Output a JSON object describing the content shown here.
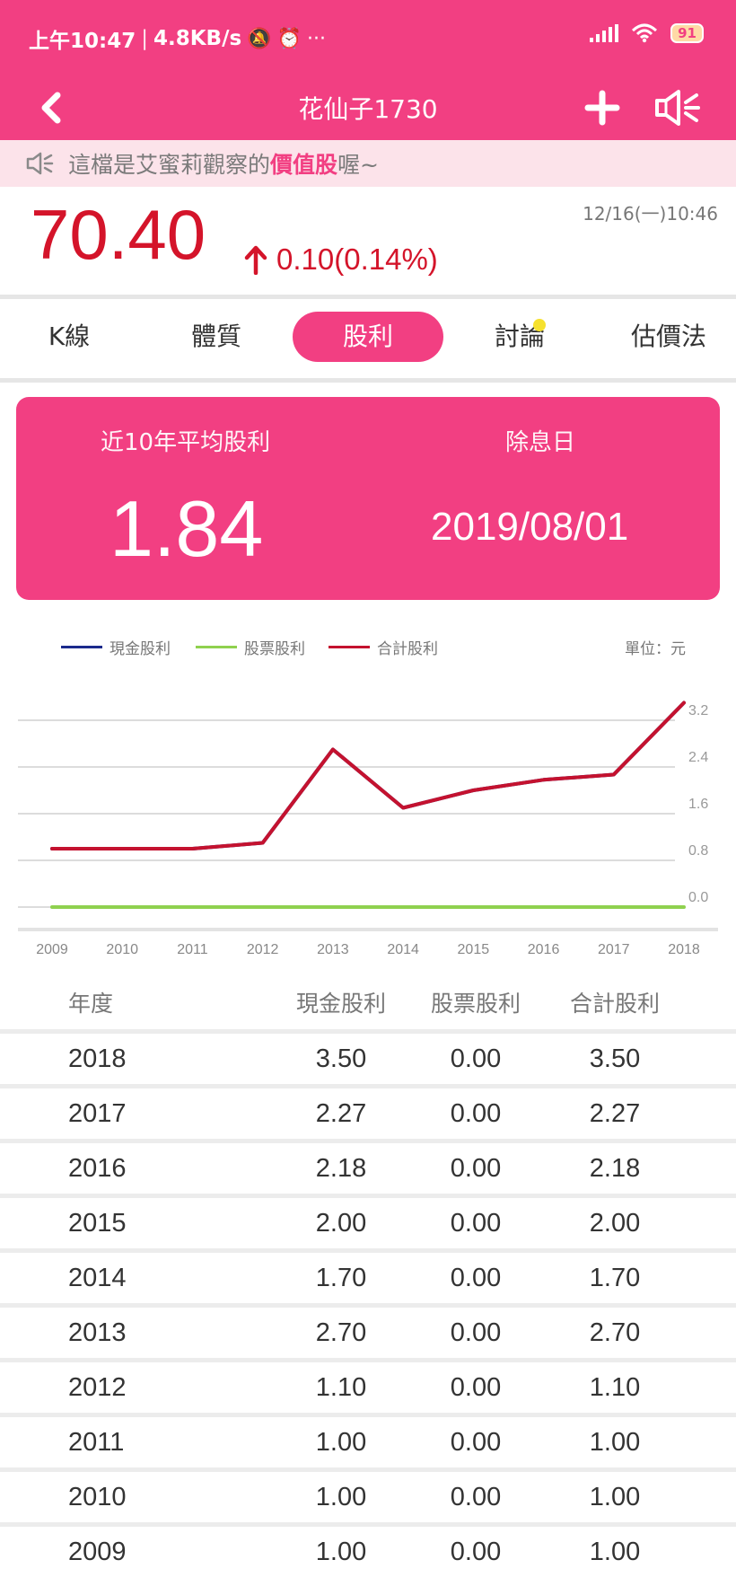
{
  "status_bar": {
    "time": "上午10:47",
    "speed": "4.8KB/s",
    "battery": "91"
  },
  "nav": {
    "title": "花仙子1730"
  },
  "notice": {
    "prefix": "這檔是艾蜜莉觀察的",
    "highlight": "價值股",
    "suffix": "喔~"
  },
  "quote": {
    "price": "70.40",
    "change": "0.10(0.14%)",
    "timestamp": "12/16(一)10:46",
    "color": "#d4142a"
  },
  "tabs": [
    {
      "label": "K線",
      "active": false
    },
    {
      "label": "體質",
      "active": false
    },
    {
      "label": "股利",
      "active": true
    },
    {
      "label": "討論",
      "active": false
    },
    {
      "label": "估價法",
      "active": false
    }
  ],
  "summary": {
    "avg_label": "近10年平均股利",
    "avg_value": "1.84",
    "exdiv_label": "除息日",
    "exdiv_value": "2019/08/01"
  },
  "legend": {
    "unit": "單位：元",
    "items": [
      {
        "label": "現金股利",
        "color": "#1b2a8c"
      },
      {
        "label": "股票股利",
        "color": "#8fd14f"
      },
      {
        "label": "合計股利",
        "color": "#c4122f"
      }
    ]
  },
  "chart_data": {
    "type": "line",
    "x": [
      "2009",
      "2010",
      "2011",
      "2012",
      "2013",
      "2014",
      "2015",
      "2016",
      "2017",
      "2018"
    ],
    "y_ticks": [
      "0.0",
      "0.8",
      "1.6",
      "2.4",
      "3.2"
    ],
    "ylim": [
      0,
      3.2
    ],
    "grid": true,
    "legend_position": "top",
    "series": [
      {
        "name": "現金股利",
        "values": [
          1.0,
          1.0,
          1.0,
          1.1,
          2.7,
          1.7,
          2.0,
          2.18,
          2.27,
          3.5
        ],
        "color": "#1b2a8c"
      },
      {
        "name": "股票股利",
        "values": [
          0,
          0,
          0,
          0,
          0,
          0,
          0,
          0,
          0,
          0
        ],
        "color": "#8fd14f"
      },
      {
        "name": "合計股利",
        "values": [
          1.0,
          1.0,
          1.0,
          1.1,
          2.7,
          1.7,
          2.0,
          2.18,
          2.27,
          3.5
        ],
        "color": "#c4122f"
      }
    ]
  },
  "table": {
    "headers": [
      "年度",
      "現金股利",
      "股票股利",
      "合計股利"
    ],
    "rows": [
      [
        "2018",
        "3.50",
        "0.00",
        "3.50"
      ],
      [
        "2017",
        "2.27",
        "0.00",
        "2.27"
      ],
      [
        "2016",
        "2.18",
        "0.00",
        "2.18"
      ],
      [
        "2015",
        "2.00",
        "0.00",
        "2.00"
      ],
      [
        "2014",
        "1.70",
        "0.00",
        "1.70"
      ],
      [
        "2013",
        "2.70",
        "0.00",
        "2.70"
      ],
      [
        "2012",
        "1.10",
        "0.00",
        "1.10"
      ],
      [
        "2011",
        "1.00",
        "0.00",
        "1.00"
      ],
      [
        "2010",
        "1.00",
        "0.00",
        "1.00"
      ],
      [
        "2009",
        "1.00",
        "0.00",
        "1.00"
      ]
    ]
  }
}
